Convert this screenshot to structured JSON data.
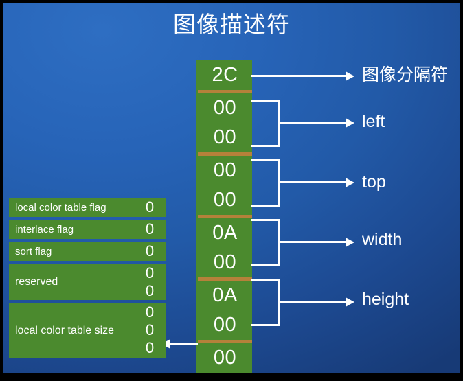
{
  "slide": {
    "title": "图像描述符",
    "background_top_color": "#2e6ec2",
    "background_bottom_color": "#173a76",
    "block_color": "#4b8a2e",
    "separator_color": "#b5813a",
    "text_color": "#ffffff"
  },
  "byte_column": {
    "groups": [
      {
        "id": "image-separator",
        "bytes": [
          "2C"
        ]
      },
      {
        "id": "left",
        "bytes": [
          "00",
          "00"
        ]
      },
      {
        "id": "top",
        "bytes": [
          "00",
          "00"
        ]
      },
      {
        "id": "width",
        "bytes": [
          "0A",
          "00"
        ]
      },
      {
        "id": "height",
        "bytes": [
          "0A",
          "00"
        ]
      },
      {
        "id": "packed-field",
        "bytes": [
          "00"
        ]
      }
    ]
  },
  "callouts": [
    {
      "id": "image-separator",
      "label": "图像分隔符",
      "kind": "single"
    },
    {
      "id": "left",
      "label": "left",
      "kind": "bracket"
    },
    {
      "id": "top",
      "label": "top",
      "kind": "bracket"
    },
    {
      "id": "width",
      "label": "width",
      "kind": "bracket"
    },
    {
      "id": "height",
      "label": "height",
      "kind": "bracket"
    }
  ],
  "flag_table": {
    "rows": [
      {
        "name": "local color table flag",
        "bits": [
          "0"
        ]
      },
      {
        "name": "interlace flag",
        "bits": [
          "0"
        ]
      },
      {
        "name": "sort flag",
        "bits": [
          "0"
        ]
      },
      {
        "name": "reserved",
        "bits": [
          "0",
          "0"
        ]
      },
      {
        "name": "local color table size",
        "bits": [
          "0",
          "0",
          "0"
        ]
      }
    ]
  }
}
